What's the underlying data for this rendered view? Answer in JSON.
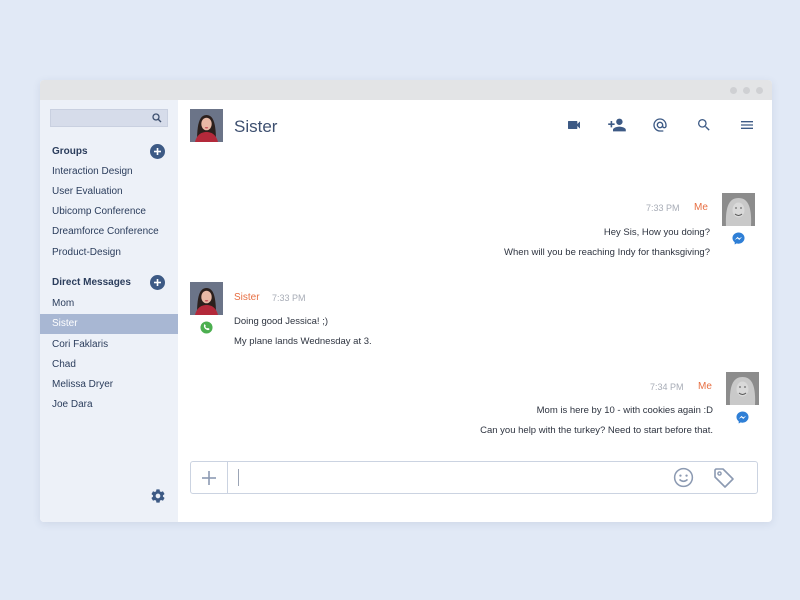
{
  "sidebar": {
    "search_placeholder": "",
    "groups": {
      "title": "Groups",
      "items": [
        "Interaction Design",
        "User Evaluation",
        "Ubicomp Conference",
        "Dreamforce Conference",
        "Product-Design"
      ]
    },
    "direct_messages": {
      "title": "Direct Messages",
      "items": [
        "Mom",
        "Sister",
        "Cori Faklaris",
        "Chad",
        "Melissa Dryer",
        "Joe Dara"
      ],
      "active": "Sister"
    }
  },
  "chat": {
    "title": "Sister",
    "messages": [
      {
        "sender": "Me",
        "time": "7:33 PM",
        "channel": "messenger-icon",
        "lines": [
          "Hey Sis, How you doing?",
          "When will you be reaching Indy for thanksgiving?"
        ]
      },
      {
        "sender": "Sister",
        "time": "7:33 PM",
        "channel": "whatsapp-icon",
        "lines": [
          "Doing good Jessica!  ;)",
          "My plane lands Wednesday at 3."
        ]
      },
      {
        "sender": "Me",
        "time": "7:34 PM",
        "channel": "messenger-icon",
        "lines": [
          "Mom is here by 10 - with cookies again :D",
          "Can you help with the turkey? Need to start before that."
        ]
      }
    ]
  },
  "composer": {
    "value": "",
    "placeholder": ""
  },
  "icons": {
    "header": [
      "video-call-icon",
      "add-person-icon",
      "mention-icon",
      "search-icon",
      "menu-icon"
    ],
    "composer": [
      "plus-icon",
      "emoji-icon",
      "tag-icon"
    ]
  },
  "colors": {
    "background": "#e1e9f6",
    "sidebar": "#edf1f8",
    "active_item": "#a8b7d3",
    "accent_dark": "#3d5a85",
    "sender_name": "#e76e42",
    "whatsapp": "#4caf50",
    "messenger": "#2f7fd6"
  }
}
